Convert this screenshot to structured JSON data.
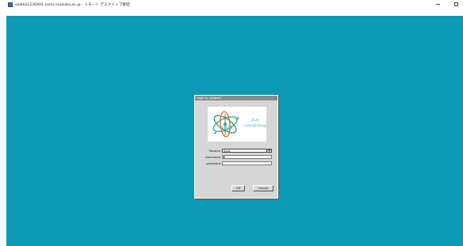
{
  "window": {
    "title": "azalea1230401.coins.tsukuba.ac.jp - リモート デスクトップ接続",
    "minimize_glyph": "−",
    "maximize_glyph": "□"
  },
  "colors": {
    "desktop_background": "#0b99b4",
    "dialog_background": "#d6d6d6",
    "dialog_titlebar": "#8a8a8a"
  },
  "dialog": {
    "title": "Login to azalea01",
    "logo": {
      "center_text": "xrdp",
      "tagline_line1": "Just",
      "tagline_line2": "connecting"
    },
    "session_label": "Session",
    "session_value": "Xorg",
    "username_label": "username",
    "username_value": "",
    "password_label": "password",
    "password_value": "",
    "ok_label": "OK",
    "cancel_label": "Cancel"
  }
}
